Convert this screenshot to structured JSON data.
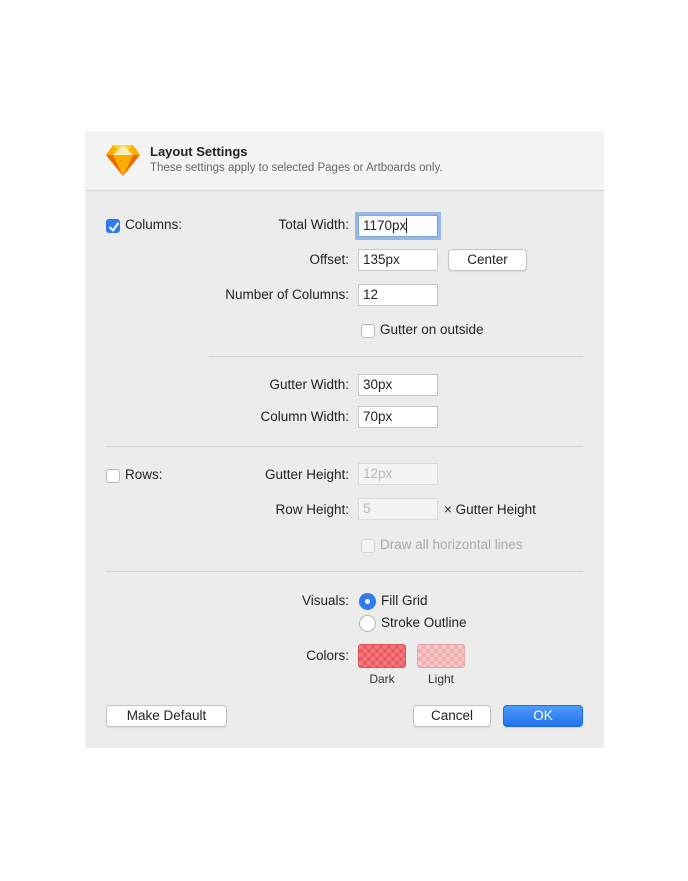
{
  "header": {
    "title": "Layout Settings",
    "subtitle": "These settings apply to selected Pages or Artboards only.",
    "app_icon": "sketch-diamond-icon"
  },
  "columns": {
    "label": "Columns:",
    "enabled": true,
    "total_width_label": "Total Width:",
    "total_width_value": "1170px",
    "offset_label": "Offset:",
    "offset_value": "135px",
    "center_button": "Center",
    "number_label": "Number of Columns:",
    "number_value": "12",
    "gutter_outside_label": "Gutter on outside",
    "gutter_outside_checked": false,
    "gutter_width_label": "Gutter Width:",
    "gutter_width_value": "30px",
    "column_width_label": "Column Width:",
    "column_width_value": "70px"
  },
  "rows": {
    "label": "Rows:",
    "enabled": false,
    "gutter_height_label": "Gutter Height:",
    "gutter_height_placeholder": "12px",
    "row_height_label": "Row Height:",
    "row_height_placeholder": "5",
    "row_height_suffix": "× Gutter Height",
    "draw_lines_label": "Draw all horizontal lines"
  },
  "visuals": {
    "label": "Visuals:",
    "options": [
      {
        "label": "Fill Grid",
        "selected": true
      },
      {
        "label": "Stroke Outline",
        "selected": false
      }
    ]
  },
  "colors": {
    "label": "Colors:",
    "dark_label": "Dark",
    "light_label": "Light",
    "dark_color": "#f4777c",
    "light_color": "#f7c6c7"
  },
  "footer": {
    "make_default": "Make Default",
    "cancel": "Cancel",
    "ok": "OK"
  },
  "accent_color": "#2f7bf0"
}
